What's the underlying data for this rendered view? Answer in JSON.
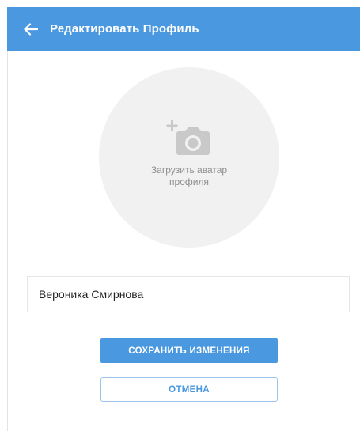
{
  "header": {
    "title": "Редактировать Профиль",
    "back_icon": "arrow-left-icon",
    "background_color": "#4a98e0"
  },
  "avatar": {
    "icon": "add-photo-camera-icon",
    "label": "Загрузить аватар профиля"
  },
  "form": {
    "name_value": "Вероника Смирнова"
  },
  "actions": {
    "save_label": "СОХРАНИТЬ ИЗМЕНЕНИЯ",
    "cancel_label": "ОТМЕНА",
    "accent_color": "#4a98e0"
  }
}
